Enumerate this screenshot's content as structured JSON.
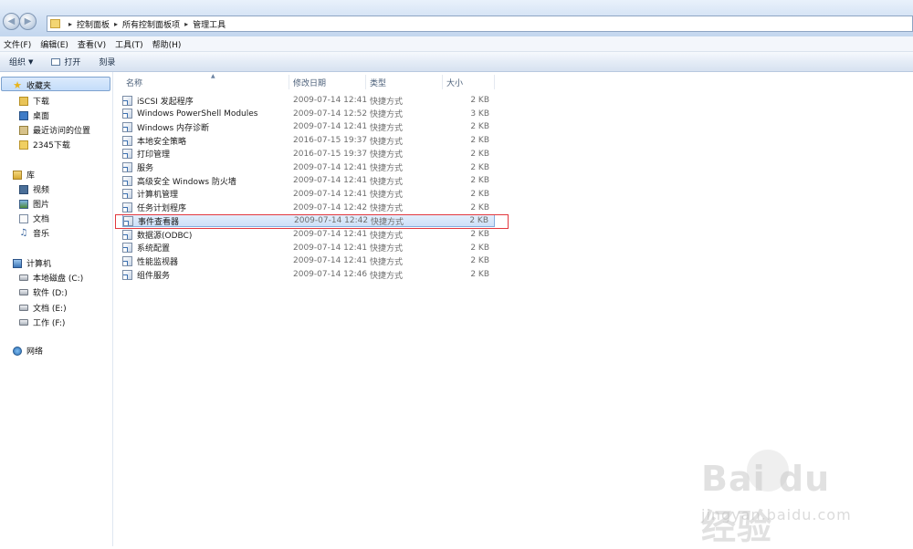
{
  "breadcrumb": [
    "控制面板",
    "所有控制面板项",
    "管理工具"
  ],
  "menu": [
    "文件(F)",
    "编辑(E)",
    "查看(V)",
    "工具(T)",
    "帮助(H)"
  ],
  "toolbar": {
    "organize": "组织",
    "open": "打开",
    "burn": "刻录"
  },
  "nav": {
    "favorites": {
      "label": "收藏夹",
      "items": [
        "下载",
        "桌面",
        "最近访问的位置",
        "2345下载"
      ]
    },
    "libraries": {
      "label": "库",
      "items": [
        "视频",
        "图片",
        "文档",
        "音乐"
      ]
    },
    "computer": {
      "label": "计算机",
      "items": [
        "本地磁盘 (C:)",
        "软件 (D:)",
        "文档 (E:)",
        "工作 (F:)"
      ]
    },
    "network": {
      "label": "网络"
    }
  },
  "columns": {
    "name": "名称",
    "date": "修改日期",
    "type": "类型",
    "size": "大小"
  },
  "files": [
    {
      "name": "iSCSI 发起程序",
      "date": "2009-07-14 12:41",
      "type": "快捷方式",
      "size": "2 KB"
    },
    {
      "name": "Windows PowerShell Modules",
      "date": "2009-07-14 12:52",
      "type": "快捷方式",
      "size": "3 KB"
    },
    {
      "name": "Windows 内存诊断",
      "date": "2009-07-14 12:41",
      "type": "快捷方式",
      "size": "2 KB"
    },
    {
      "name": "本地安全策略",
      "date": "2016-07-15 19:37",
      "type": "快捷方式",
      "size": "2 KB"
    },
    {
      "name": "打印管理",
      "date": "2016-07-15 19:37",
      "type": "快捷方式",
      "size": "2 KB"
    },
    {
      "name": "服务",
      "date": "2009-07-14 12:41",
      "type": "快捷方式",
      "size": "2 KB"
    },
    {
      "name": "高级安全 Windows 防火墙",
      "date": "2009-07-14 12:41",
      "type": "快捷方式",
      "size": "2 KB"
    },
    {
      "name": "计算机管理",
      "date": "2009-07-14 12:41",
      "type": "快捷方式",
      "size": "2 KB"
    },
    {
      "name": "任务计划程序",
      "date": "2009-07-14 12:42",
      "type": "快捷方式",
      "size": "2 KB"
    },
    {
      "name": "事件查看器",
      "date": "2009-07-14 12:42",
      "type": "快捷方式",
      "size": "2 KB"
    },
    {
      "name": "数据源(ODBC)",
      "date": "2009-07-14 12:41",
      "type": "快捷方式",
      "size": "2 KB"
    },
    {
      "name": "系统配置",
      "date": "2009-07-14 12:41",
      "type": "快捷方式",
      "size": "2 KB"
    },
    {
      "name": "性能监视器",
      "date": "2009-07-14 12:41",
      "type": "快捷方式",
      "size": "2 KB"
    },
    {
      "name": "组件服务",
      "date": "2009-07-14 12:46",
      "type": "快捷方式",
      "size": "2 KB"
    }
  ],
  "selected_file": "事件查看器",
  "watermark": {
    "brand": "Bai du 经验",
    "url": "jingyan.baidu.com"
  },
  "colors": {
    "highlight_box": "#e2383e",
    "selection": "#cde0f8"
  }
}
